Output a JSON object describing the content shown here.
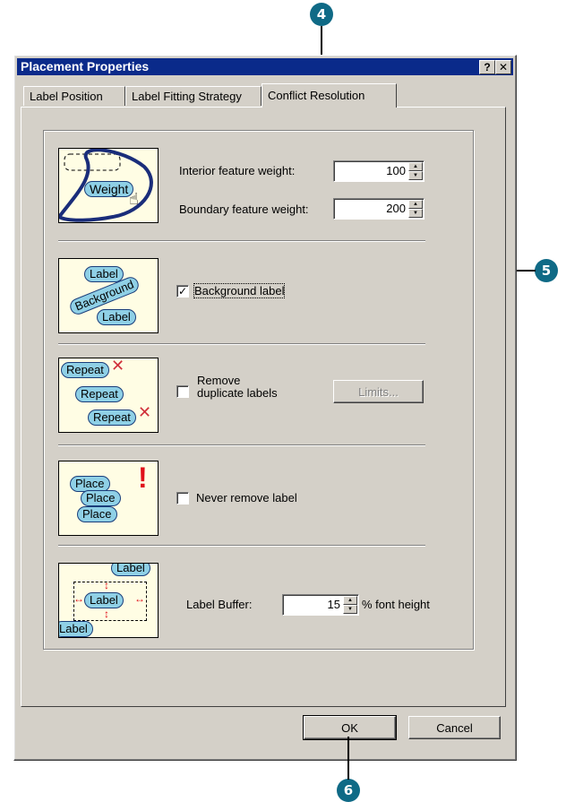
{
  "dialog": {
    "title": "Placement Properties",
    "help_button": "?",
    "close_button": "✕"
  },
  "tabs": [
    {
      "label": "Label Position"
    },
    {
      "label": "Label Fitting Strategy"
    },
    {
      "label": "Conflict Resolution"
    }
  ],
  "weights": {
    "interior_label": "Interior feature weight:",
    "interior_value": "100",
    "boundary_label": "Boundary feature weight:",
    "boundary_value": "200",
    "illustration_text": "Weight"
  },
  "background": {
    "checkbox_label": "Background label",
    "checked": true,
    "illustration_top": "Label",
    "illustration_diag": "Background",
    "illustration_bottom": "Label"
  },
  "duplicates": {
    "checkbox_label_line1": "Remove",
    "checkbox_label_line2": "duplicate labels",
    "checked": false,
    "limits_button": "Limits...",
    "illustration_text": "Repeat"
  },
  "never_remove": {
    "checkbox_label": "Never remove label",
    "checked": false,
    "illustration_text": "Place",
    "exclamation": "!"
  },
  "buffer": {
    "label": "Label Buffer:",
    "value": "15",
    "unit": "% font height",
    "illustration_text": "Label"
  },
  "buttons": {
    "ok": "OK",
    "cancel": "Cancel"
  },
  "callouts": {
    "c4": "4",
    "c5": "5",
    "c6": "6"
  },
  "colors": {
    "title_bar": "#0a2a8a",
    "dialog_face": "#d4d0c8",
    "callout": "#0f6a86",
    "illustration_bg": "#fffde4",
    "label_pill": "#8fd0e6"
  }
}
